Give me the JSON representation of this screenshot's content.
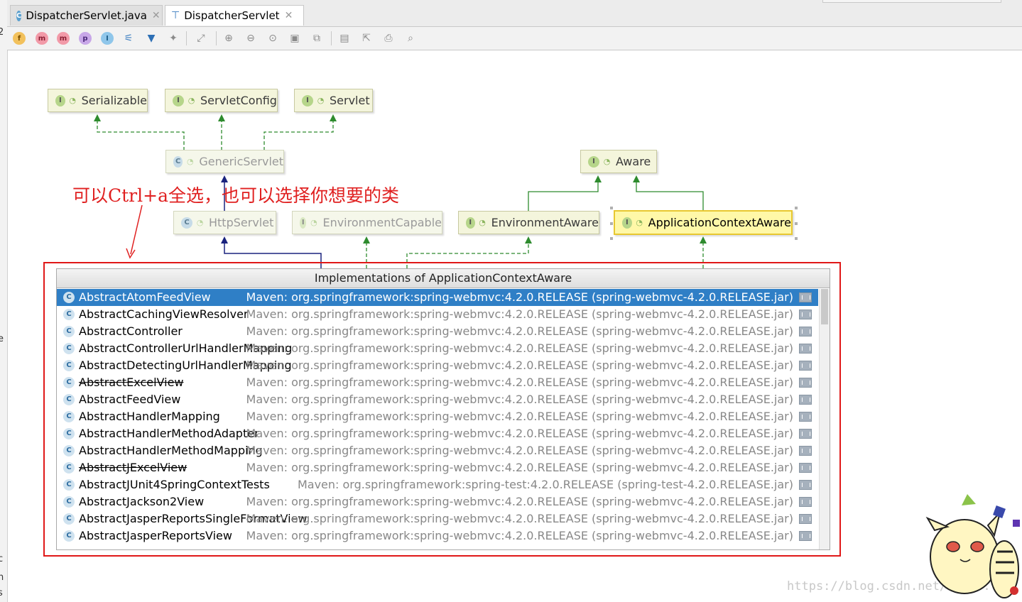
{
  "tabs": [
    {
      "label": "DispatcherServlet.java",
      "icon": "class-icon"
    },
    {
      "label": "DispatcherServlet",
      "icon": "diagram-icon"
    }
  ],
  "toolbar": {
    "buttons": [
      "f",
      "m",
      "m",
      "p",
      "I"
    ]
  },
  "diagram": {
    "nodes": {
      "serializable": "Serializable",
      "servletconfig": "ServletConfig",
      "servlet": "Servlet",
      "genericservlet": "GenericServlet",
      "aware": "Aware",
      "httpservlet": "HttpServlet",
      "environmentcapable": "EnvironmentCapable",
      "environmentaware": "EnvironmentAware",
      "applicationcontextaware": "ApplicationContextAware"
    },
    "icon_letters": {
      "interface": "I",
      "class": "C"
    }
  },
  "annotation": "可以Ctrl+a全选，也可以选择你想要的类",
  "popup": {
    "title": "Implementations of ApplicationContextAware",
    "rows": [
      {
        "name": "AbstractAtomFeedView",
        "source": "Maven: org.springframework:spring-webmvc:4.2.0.RELEASE (spring-webmvc-4.2.0.RELEASE.jar)",
        "selected": true,
        "strike": false
      },
      {
        "name": "AbstractCachingViewResolver",
        "source": "Maven: org.springframework:spring-webmvc:4.2.0.RELEASE (spring-webmvc-4.2.0.RELEASE.jar)",
        "selected": false,
        "strike": false
      },
      {
        "name": "AbstractController",
        "source": "Maven: org.springframework:spring-webmvc:4.2.0.RELEASE (spring-webmvc-4.2.0.RELEASE.jar)",
        "selected": false,
        "strike": false
      },
      {
        "name": "AbstractControllerUrlHandlerMapping",
        "source": "Maven: org.springframework:spring-webmvc:4.2.0.RELEASE (spring-webmvc-4.2.0.RELEASE.jar)",
        "selected": false,
        "strike": false
      },
      {
        "name": "AbstractDetectingUrlHandlerMapping",
        "source": "Maven: org.springframework:spring-webmvc:4.2.0.RELEASE (spring-webmvc-4.2.0.RELEASE.jar)",
        "selected": false,
        "strike": false
      },
      {
        "name": "AbstractExcelView",
        "source": "Maven: org.springframework:spring-webmvc:4.2.0.RELEASE (spring-webmvc-4.2.0.RELEASE.jar)",
        "selected": false,
        "strike": true
      },
      {
        "name": "AbstractFeedView",
        "source": "Maven: org.springframework:spring-webmvc:4.2.0.RELEASE (spring-webmvc-4.2.0.RELEASE.jar)",
        "selected": false,
        "strike": false
      },
      {
        "name": "AbstractHandlerMapping",
        "source": "Maven: org.springframework:spring-webmvc:4.2.0.RELEASE (spring-webmvc-4.2.0.RELEASE.jar)",
        "selected": false,
        "strike": false
      },
      {
        "name": "AbstractHandlerMethodAdapter",
        "source": "Maven: org.springframework:spring-webmvc:4.2.0.RELEASE (spring-webmvc-4.2.0.RELEASE.jar)",
        "selected": false,
        "strike": false
      },
      {
        "name": "AbstractHandlerMethodMapping",
        "source": "Maven: org.springframework:spring-webmvc:4.2.0.RELEASE (spring-webmvc-4.2.0.RELEASE.jar)",
        "selected": false,
        "strike": false
      },
      {
        "name": "AbstractJExcelView",
        "source": "Maven: org.springframework:spring-webmvc:4.2.0.RELEASE (spring-webmvc-4.2.0.RELEASE.jar)",
        "selected": false,
        "strike": true
      },
      {
        "name": "AbstractJUnit4SpringContextTests",
        "source": "Maven: org.springframework:spring-test:4.2.0.RELEASE (spring-test-4.2.0.RELEASE.jar)",
        "selected": false,
        "strike": false
      },
      {
        "name": "AbstractJackson2View",
        "source": "Maven: org.springframework:spring-webmvc:4.2.0.RELEASE (spring-webmvc-4.2.0.RELEASE.jar)",
        "selected": false,
        "strike": false
      },
      {
        "name": "AbstractJasperReportsSingleFormatView",
        "source": "Maven: org.springframework:spring-webmvc:4.2.0.RELEASE (spring-webmvc-4.2.0.RELEASE.jar)",
        "selected": false,
        "strike": false
      },
      {
        "name": "AbstractJasperReportsView",
        "source": "Maven: org.springframework:spring-webmvc:4.2.0.RELEASE (spring-webmvc-4.2.0.RELEASE.jar)",
        "selected": false,
        "strike": false
      }
    ]
  },
  "watermark": "https://blog.csdn.net/u010...72",
  "colors": {
    "selection": "#2f7fc6",
    "annotation_red": "#e02020",
    "implements_edge": "#2e8b2e",
    "extends_edge": "#1a237e"
  }
}
